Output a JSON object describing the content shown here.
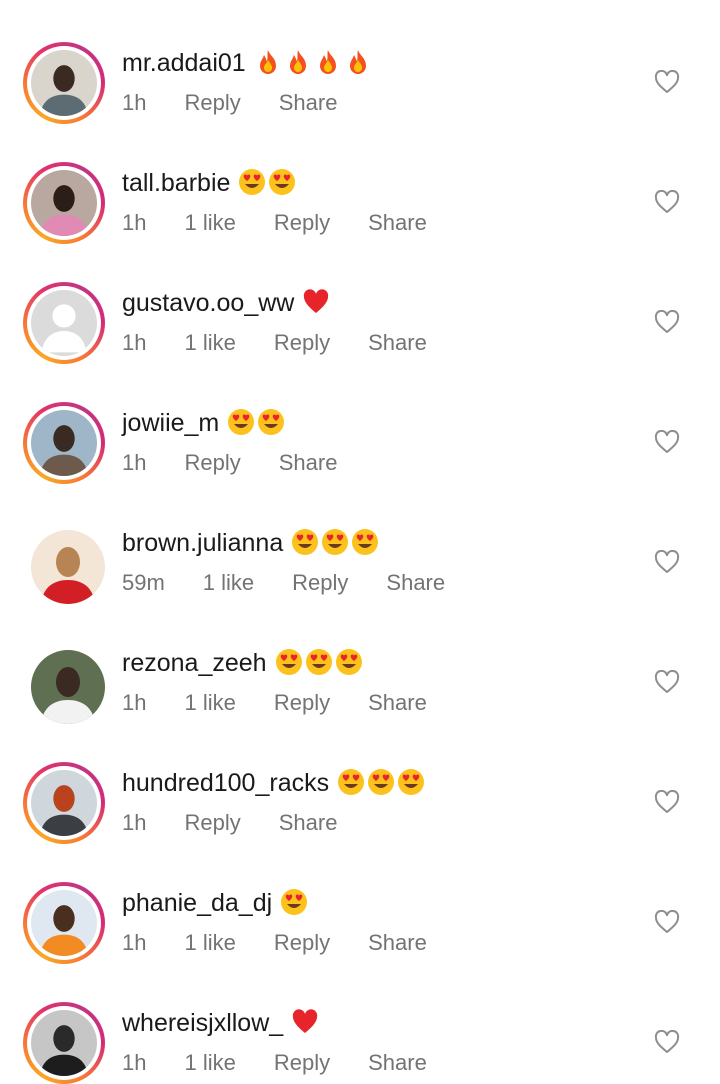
{
  "comments": [
    {
      "username": "mr.addai01",
      "emoji": [
        "fire",
        "fire",
        "fire",
        "fire"
      ],
      "time": "1h",
      "likes": "",
      "reply": "Reply",
      "share": "Share",
      "avatar": "man-glasses",
      "story_ring": true
    },
    {
      "username": "tall.barbie",
      "emoji": [
        "heart-eyes",
        "heart-eyes"
      ],
      "time": "1h",
      "likes": "1 like",
      "reply": "Reply",
      "share": "Share",
      "avatar": "woman-braids",
      "story_ring": true
    },
    {
      "username": "gustavo.oo_ww",
      "emoji": [
        "red-heart"
      ],
      "time": "1h",
      "likes": "1 like",
      "reply": "Reply",
      "share": "Share",
      "avatar": "default-avatar",
      "story_ring": true
    },
    {
      "username": "jowiie_m",
      "emoji": [
        "heart-eyes",
        "heart-eyes"
      ],
      "time": "1h",
      "likes": "",
      "reply": "Reply",
      "share": "Share",
      "avatar": "woman-outdoor",
      "story_ring": true
    },
    {
      "username": "brown.julianna",
      "emoji": [
        "heart-eyes",
        "heart-eyes",
        "heart-eyes"
      ],
      "time": "59m",
      "likes": "1 like",
      "reply": "Reply",
      "share": "Share",
      "avatar": "woman-red-hat",
      "story_ring": false
    },
    {
      "username": "rezona_zeeh",
      "emoji": [
        "heart-eyes",
        "heart-eyes",
        "heart-eyes"
      ],
      "time": "1h",
      "likes": "1 like",
      "reply": "Reply",
      "share": "Share",
      "avatar": "woman-white-outfit",
      "story_ring": false
    },
    {
      "username": "hundred100_racks",
      "emoji": [
        "heart-eyes",
        "heart-eyes",
        "heart-eyes"
      ],
      "time": "1h",
      "likes": "",
      "reply": "Reply",
      "share": "Share",
      "avatar": "woman-red-hair",
      "story_ring": true
    },
    {
      "username": "phanie_da_dj",
      "emoji": [
        "heart-eyes"
      ],
      "time": "1h",
      "likes": "1 like",
      "reply": "Reply",
      "share": "Share",
      "avatar": "man-blue-hair",
      "story_ring": true
    },
    {
      "username": "whereisjxllow_",
      "emoji": [
        "red-heart"
      ],
      "time": "1h",
      "likes": "1 like",
      "reply": "Reply",
      "share": "Share",
      "avatar": "man-dark",
      "story_ring": true
    }
  ],
  "colors": {
    "text": "#1a1a1a",
    "meta": "#737373",
    "ring_start": "#f9a825",
    "ring_end": "#c13584"
  },
  "like_icon": "heart-outline-icon"
}
